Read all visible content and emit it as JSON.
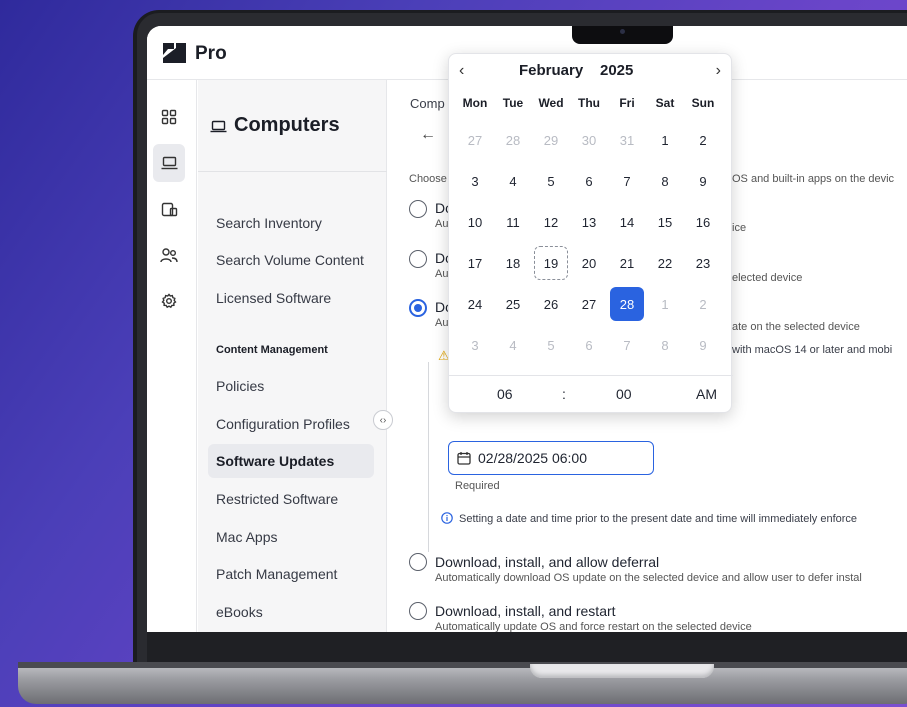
{
  "app": {
    "brand": "Pro"
  },
  "sidebar": {
    "title": "Computers",
    "items": [
      {
        "label": "Search Inventory"
      },
      {
        "label": "Search Volume Content"
      },
      {
        "label": "Licensed Software"
      }
    ],
    "section": "Content Management",
    "items2": [
      {
        "label": "Policies"
      },
      {
        "label": "Configuration Profiles"
      },
      {
        "label": "Software Updates"
      },
      {
        "label": "Restricted Software"
      },
      {
        "label": "Mac Apps"
      },
      {
        "label": "Patch Management"
      },
      {
        "label": "eBooks"
      }
    ]
  },
  "main": {
    "breadcrumb": "Comp",
    "choose_left": "Choose",
    "choose_right": "OS and built-in apps on the devic",
    "option1": {
      "title": "Do",
      "desc": "Au",
      "right": "ice"
    },
    "option2": {
      "title": "Do",
      "desc": "Au",
      "right": "elected device"
    },
    "option3": {
      "title": "Do",
      "desc": "Au",
      "right": "ate on the selected device"
    },
    "warning_right": "with macOS 14 or later and mobi",
    "datetime_value": "02/28/2025 06:00",
    "required": "Required",
    "info_note": "Setting a date and time prior to the present date and time will immediately enforce",
    "option4": {
      "title": "Download, install, and allow deferral",
      "desc": "Automatically download OS update on the selected device and allow user to defer instal"
    },
    "option5": {
      "title": "Download, install, and restart",
      "desc": "Automatically update OS and force restart on the selected device"
    }
  },
  "calendar": {
    "month": "February",
    "year": "2025",
    "weekdays": [
      "Mon",
      "Tue",
      "Wed",
      "Thu",
      "Fri",
      "Sat",
      "Sun"
    ],
    "weeks": [
      [
        "27",
        "28",
        "29",
        "30",
        "31",
        "1",
        "2"
      ],
      [
        "3",
        "4",
        "5",
        "6",
        "7",
        "8",
        "9"
      ],
      [
        "10",
        "11",
        "12",
        "13",
        "14",
        "15",
        "16"
      ],
      [
        "17",
        "18",
        "19",
        "20",
        "21",
        "22",
        "23"
      ],
      [
        "24",
        "25",
        "26",
        "27",
        "28",
        "1",
        "2"
      ],
      [
        "3",
        "4",
        "5",
        "6",
        "7",
        "8",
        "9"
      ]
    ],
    "today": "19",
    "selected": "28",
    "hour": "06",
    "separator": ":",
    "minute": "00",
    "meridiem": "AM"
  },
  "colors": {
    "accent": "#2a63e0",
    "warning": "#e0a300"
  }
}
